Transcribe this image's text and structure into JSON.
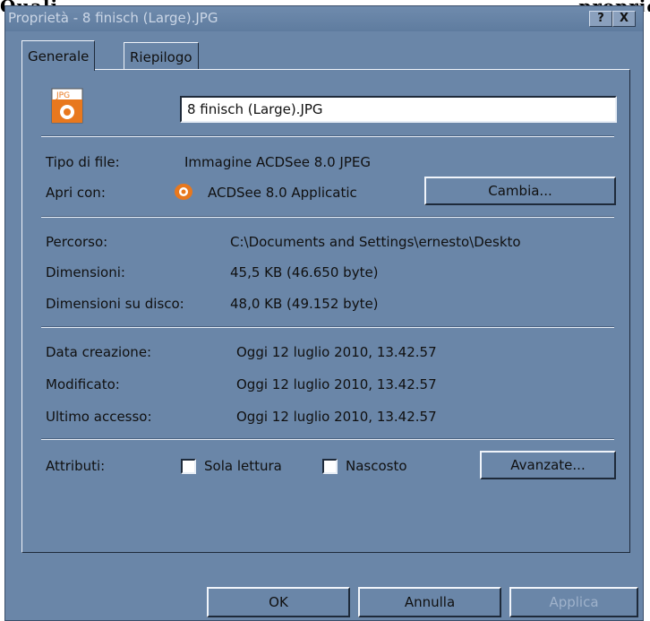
{
  "window": {
    "title": "Proprietà - 8 finisch (Large).JPG",
    "help_label": "?",
    "close_label": "X"
  },
  "tabs": [
    {
      "label": "Generale",
      "active": true
    },
    {
      "label": "Riepilogo",
      "active": false
    }
  ],
  "general": {
    "file_icon_label": "JPG",
    "filename": "8 finisch (Large).JPG",
    "file_type_label": "Tipo di file:",
    "file_type_value": "Immagine ACDSee 8.0 JPEG",
    "open_with_label": "Apri con:",
    "open_with_value": "ACDSee 8.0 Applicatic",
    "change_button": "Cambia...",
    "path_label": "Percorso:",
    "path_value": "C:\\Documents and Settings\\ernesto\\Deskto",
    "size_label": "Dimensioni:",
    "size_value": "45,5 KB (46.650 byte)",
    "disk_size_label": "Dimensioni su disco:",
    "disk_size_value": "48,0 KB (49.152 byte)",
    "created_label": "Data creazione:",
    "created_value": "Oggi 12 luglio 2010, 13.42.57",
    "modified_label": "Modificato:",
    "modified_value": "Oggi 12 luglio 2010, 13.42.57",
    "accessed_label": "Ultimo accesso:",
    "accessed_value": "Oggi 12 luglio 2010, 13.42.57",
    "attributes_label": "Attributi:",
    "readonly_label": "Sola lettura",
    "hidden_label": "Nascosto",
    "advanced_button": "Avanzate..."
  },
  "footer": {
    "ok": "OK",
    "cancel": "Annulla",
    "apply": "Applica"
  },
  "colors": {
    "dialog_bg": "#6a86a8",
    "title_text": "#cbd6e6",
    "jpg_icon": "#e8781e"
  }
}
